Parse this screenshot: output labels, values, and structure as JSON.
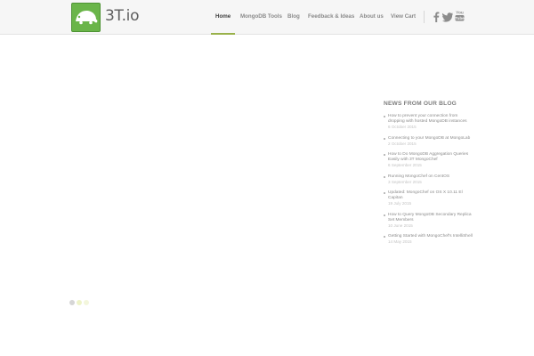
{
  "brand": {
    "name": "3T.io",
    "logo_icon": "chameleon-logo-icon",
    "logo_color": "#6ab549"
  },
  "nav": {
    "items": [
      {
        "label": "Home",
        "active": true
      },
      {
        "label": "MongoDB Tools",
        "active": false
      },
      {
        "label": "Blog",
        "active": false
      },
      {
        "label": "Feedback & Ideas",
        "active": false
      },
      {
        "label": "About us",
        "active": false
      },
      {
        "label": "View Cart",
        "active": false
      }
    ],
    "active_color": "#99b14a"
  },
  "social": [
    {
      "icon": "facebook-icon"
    },
    {
      "icon": "twitter-icon"
    },
    {
      "icon": "youtube-icon",
      "label": "You Tube"
    }
  ],
  "blog": {
    "title": "NEWS FROM OUR BLOG",
    "posts": [
      {
        "title": "How to prevent your connection from dropping with hosted MongoDB instances",
        "date": "6 October 2015"
      },
      {
        "title": "Connecting to your MongoDB at MongoLab",
        "date": "2 October 2015"
      },
      {
        "title": "How to Do MongoDB Aggregation Queries Easily with 3T MongoChef",
        "date": "6 September 2015"
      },
      {
        "title": "Running MongoChef on CentOS",
        "date": "3 September 2015"
      },
      {
        "title": "Updated: MongoChef on OS X 10.11 El Capitan",
        "date": "19 July 2015"
      },
      {
        "title": "How to Query MongoDB Secondary Replica Set Members",
        "date": "10 June 2015"
      },
      {
        "title": "Getting Started with MongoChef's IntelliShell",
        "date": "14 May 2015"
      }
    ]
  },
  "loader": {
    "dot_colors": [
      "#d6d6d6",
      "#eef3c8",
      "#f3f6dc"
    ]
  }
}
